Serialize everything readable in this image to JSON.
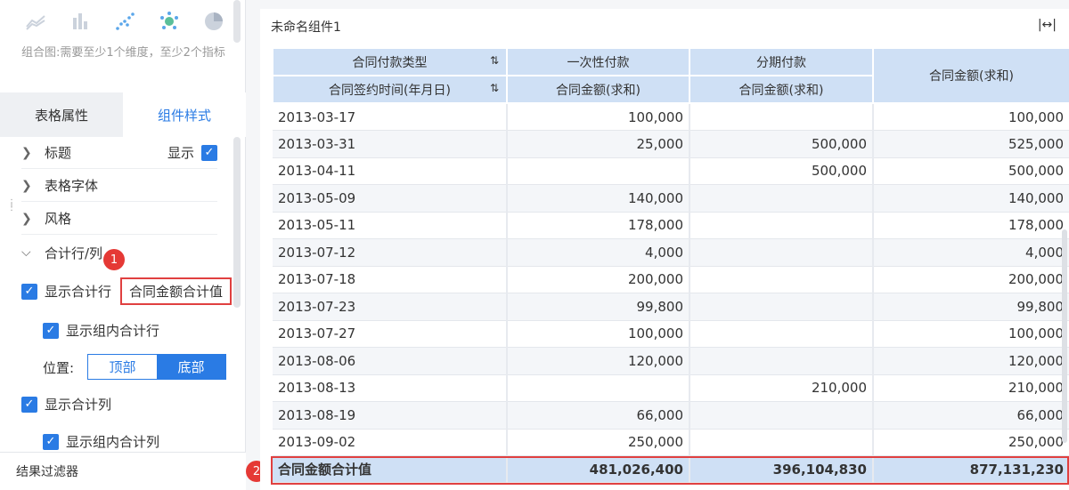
{
  "left": {
    "chart_icons": [
      "area-chart-icon",
      "bar-chart-icon",
      "scatter-chart-icon",
      "bubble-chart-icon",
      "pie-chart-icon"
    ],
    "hint": "组合图:需要至少1个维度，至少2个指标",
    "tabs": [
      "表格属性",
      "组件样式"
    ],
    "sections": {
      "title": "标题",
      "title_show": "显示",
      "font": "表格字体",
      "style": "风格",
      "total": "合计行/列"
    },
    "show_total_row": "显示合计行",
    "total_name_value": "合同金额合计值",
    "show_group_total_row": "显示组内合计行",
    "position_label": "位置:",
    "position_options": [
      "顶部",
      "底部"
    ],
    "show_total_col": "显示合计列",
    "show_group_total_col": "显示组内合计列",
    "filter": "结果过滤器",
    "badge1": "1"
  },
  "right": {
    "component_title": "未命名组件1",
    "badge2": "2"
  },
  "table": {
    "header_row1": [
      "合同付款类型",
      "一次性付款",
      "分期付款",
      "合同金额(求和)"
    ],
    "header_row2": [
      "合同签约时间(年月日)",
      "合同金额(求和)",
      "合同金额(求和)"
    ],
    "rows": [
      [
        "2013-03-17",
        "100,000",
        "",
        "100,000"
      ],
      [
        "2013-03-31",
        "25,000",
        "500,000",
        "525,000"
      ],
      [
        "2013-04-11",
        "",
        "500,000",
        "500,000"
      ],
      [
        "2013-05-09",
        "140,000",
        "",
        "140,000"
      ],
      [
        "2013-05-11",
        "178,000",
        "",
        "178,000"
      ],
      [
        "2013-07-12",
        "4,000",
        "",
        "4,000"
      ],
      [
        "2013-07-18",
        "200,000",
        "",
        "200,000"
      ],
      [
        "2013-07-23",
        "99,800",
        "",
        "99,800"
      ],
      [
        "2013-07-27",
        "100,000",
        "",
        "100,000"
      ],
      [
        "2013-08-06",
        "120,000",
        "",
        "120,000"
      ],
      [
        "2013-08-13",
        "",
        "210,000",
        "210,000"
      ],
      [
        "2013-08-19",
        "66,000",
        "",
        "66,000"
      ],
      [
        "2013-09-02",
        "250,000",
        "",
        "250,000"
      ]
    ],
    "total": [
      "合同金额合计值",
      "481,026,400",
      "396,104,830",
      "877,131,230"
    ]
  },
  "colors": {
    "accent": "#2a7be4",
    "header_bg": "#cfe0f5",
    "highlight": "#e04040"
  }
}
